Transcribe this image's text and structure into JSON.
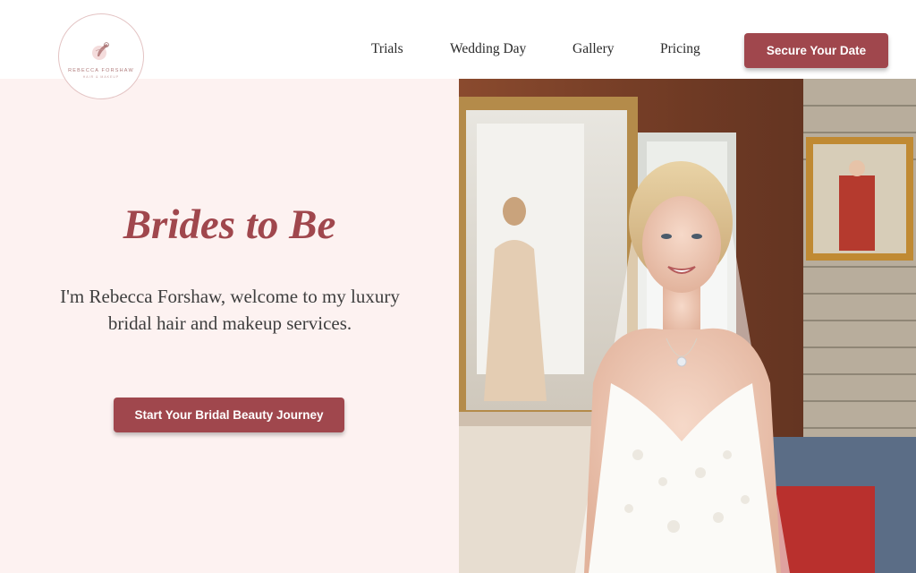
{
  "brand": {
    "name": "REBECCA FORSHAW",
    "tagline": "HAIR & MAKEUP"
  },
  "nav": {
    "items": [
      {
        "label": "Trials"
      },
      {
        "label": "Wedding Day"
      },
      {
        "label": "Gallery"
      },
      {
        "label": "Pricing"
      }
    ],
    "cta_label": "Secure Your Date"
  },
  "hero": {
    "title": "Brides to Be",
    "text": "I'm Rebecca Forshaw, welcome to my luxury bridal hair and makeup services.",
    "cta_label": "Start Your Bridal Beauty Journey"
  },
  "colors": {
    "accent": "#a0474d",
    "panel_bg": "#fdf2f1",
    "nav_text": "#2a2a2a"
  }
}
